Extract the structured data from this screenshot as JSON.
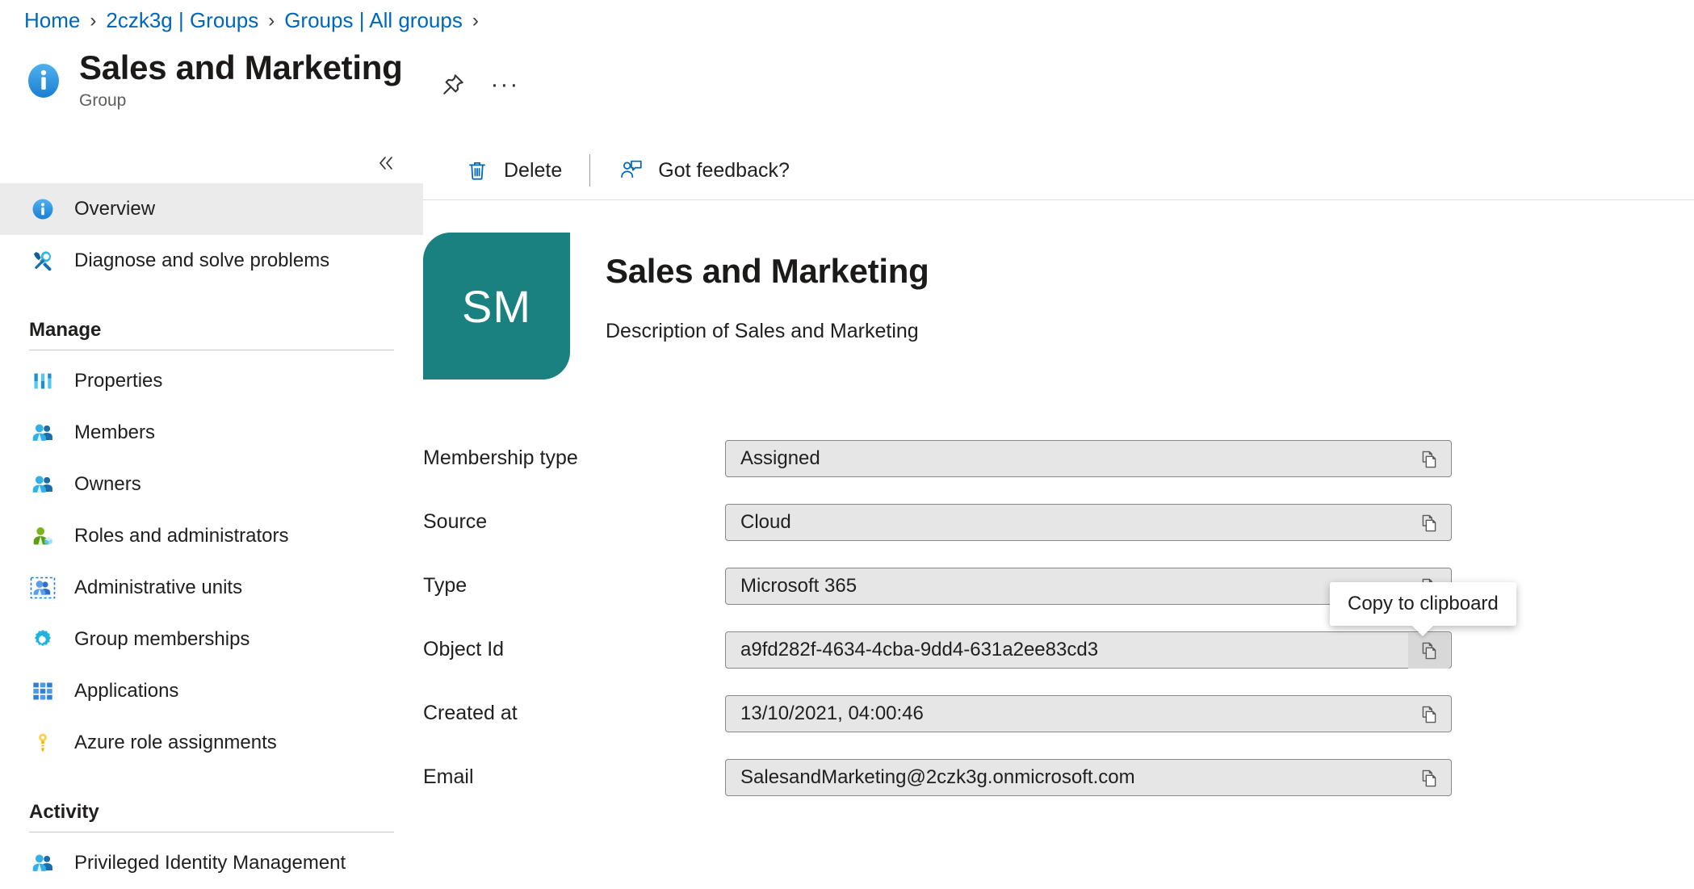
{
  "breadcrumb": {
    "items": [
      {
        "label": "Home"
      },
      {
        "label": "2czk3g | Groups"
      },
      {
        "label": "Groups | All groups"
      }
    ],
    "separator": "›"
  },
  "header": {
    "title": "Sales and Marketing",
    "subtitle": "Group",
    "info_icon": "info-icon",
    "pin_icon": "pin-icon",
    "more_label": "···"
  },
  "sidebar": {
    "collapse_icon": "double-chevron-left-icon",
    "top_items": [
      {
        "label": "Overview",
        "icon": "info-icon",
        "selected": true
      },
      {
        "label": "Diagnose and solve problems",
        "icon": "tools-icon",
        "selected": false
      }
    ],
    "sections": [
      {
        "title": "Manage",
        "items": [
          {
            "label": "Properties",
            "icon": "properties-bars-icon"
          },
          {
            "label": "Members",
            "icon": "people-icon"
          },
          {
            "label": "Owners",
            "icon": "people-icon"
          },
          {
            "label": "Roles and administrators",
            "icon": "person-role-icon"
          },
          {
            "label": "Administrative units",
            "icon": "administrative-units-icon"
          },
          {
            "label": "Group memberships",
            "icon": "gear-icon"
          },
          {
            "label": "Applications",
            "icon": "grid-apps-icon"
          },
          {
            "label": "Azure role assignments",
            "icon": "key-icon"
          }
        ]
      },
      {
        "title": "Activity",
        "items": [
          {
            "label": "Privileged Identity Management",
            "icon": "people-icon"
          }
        ]
      }
    ]
  },
  "toolbar": {
    "delete_label": "Delete",
    "delete_icon": "trash-icon",
    "feedback_label": "Got feedback?",
    "feedback_icon": "feedback-person-icon"
  },
  "group": {
    "initials": "SM",
    "name": "Sales and Marketing",
    "description": "Description of Sales and Marketing",
    "avatar_color": "#1a8080"
  },
  "fields": [
    {
      "label": "Membership type",
      "value": "Assigned",
      "copy_icon": "copy-icon",
      "hovered": false
    },
    {
      "label": "Source",
      "value": "Cloud",
      "copy_icon": "copy-icon",
      "hovered": false
    },
    {
      "label": "Type",
      "value": "Microsoft 365",
      "copy_icon": "copy-icon",
      "hovered": false
    },
    {
      "label": "Object Id",
      "value": "a9fd282f-4634-4cba-9dd4-631a2ee83cd3",
      "copy_icon": "copy-icon",
      "hovered": true
    },
    {
      "label": "Created at",
      "value": "13/10/2021, 04:00:46",
      "copy_icon": "copy-icon",
      "hovered": false
    },
    {
      "label": "Email",
      "value": "SalesandMarketing@2czk3g.onmicrosoft.com",
      "copy_icon": "copy-icon",
      "hovered": false
    }
  ],
  "tooltip": {
    "text": "Copy to clipboard"
  },
  "colors": {
    "link": "#0067b8",
    "accent_teal": "#1a8080",
    "field_bg": "#e6e6e6",
    "field_border": "#8a8886",
    "selected_bg": "#ebebeb"
  }
}
